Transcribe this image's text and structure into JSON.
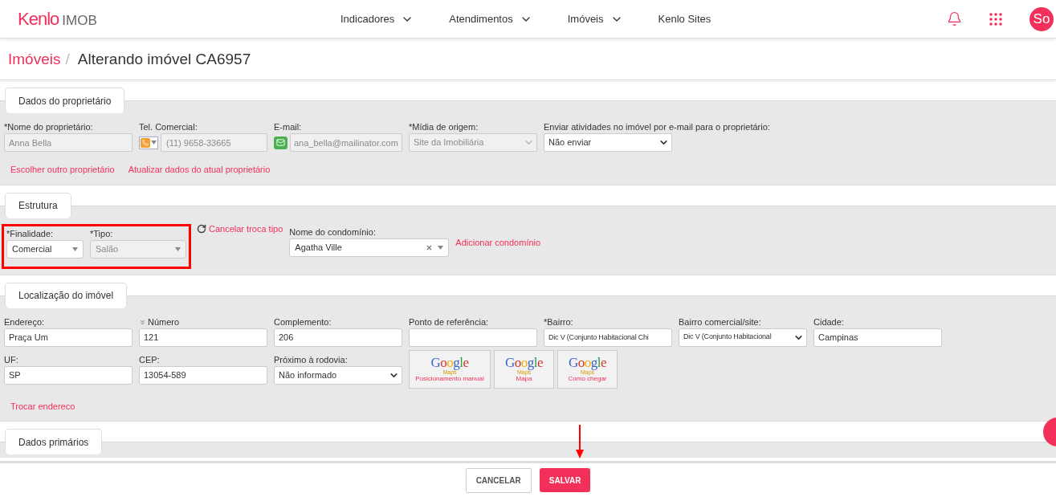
{
  "header": {
    "logo": {
      "brand": "Kenlo",
      "product": "IMOB"
    },
    "nav": [
      {
        "label": "Indicadores",
        "dropdown": true
      },
      {
        "label": "Atendimentos",
        "dropdown": true
      },
      {
        "label": "Imóveis",
        "dropdown": true
      },
      {
        "label": "Kenlo Sites",
        "dropdown": false
      }
    ],
    "avatar": "So"
  },
  "breadcrumb": {
    "parent": "Imóveis",
    "separator": "/",
    "title": "Alterando imóvel CA6957"
  },
  "sections": [
    {
      "title": "Dados do proprietário",
      "rows": [
        [
          {
            "kind": "text",
            "label": "*Nome do proprietário:",
            "value": "Anna Bella",
            "disabled": true
          },
          {
            "kind": "phone",
            "label": "Tel. Comercial:",
            "value": "(11) 9658-33665",
            "disabled": true
          },
          {
            "kind": "email",
            "label": "E-mail:",
            "value": "ana_bella@mailinator.com",
            "disabled": true
          },
          {
            "kind": "select",
            "label": "*Mídia de origem:",
            "value": "Site da Imobiliária",
            "disabled": true
          },
          {
            "kind": "select",
            "label": "Enviar atividades no imóvel por e-mail para o proprietário:",
            "value": "Não enviar",
            "disabled": false
          }
        ]
      ],
      "links": [
        "Escolher outro proprietário",
        "Atualizar dados do atual proprietário"
      ]
    },
    {
      "title": "Estrutura",
      "rows": [
        [
          {
            "kind": "group",
            "highlighted": true,
            "fields": [
              {
                "kind": "select2",
                "label": "*Finalidade:",
                "value": "Comercial",
                "disabled": false
              },
              {
                "kind": "select2",
                "label": "*Tipo:",
                "value": "Salão",
                "disabled": true
              }
            ]
          },
          {
            "kind": "action",
            "label": "Cancelar troca tipo"
          },
          {
            "kind": "select2",
            "label": "Nome do condomínio:",
            "value": "Agatha Ville",
            "disabled": false,
            "clearable": true
          },
          {
            "kind": "link",
            "label": "Adicionar condomínio"
          }
        ]
      ]
    },
    {
      "title": "Localização do imóvel",
      "rows": [
        [
          {
            "kind": "text",
            "label": "Endereço:",
            "value": "Praça Um",
            "disabled": false
          },
          {
            "kind": "text",
            "label": "Número",
            "value": "121",
            "disabled": false,
            "expand_icon": true
          },
          {
            "kind": "text",
            "label": "Complemento:",
            "value": "206",
            "disabled": false
          },
          {
            "kind": "text",
            "label": "Ponto de referência:",
            "disabled": false
          },
          {
            "kind": "text",
            "label": "*Bairro:",
            "value": "Dic V (Conjunto Habitacional Chi",
            "disabled": false
          },
          {
            "kind": "select",
            "label": "Bairro comercial/site:",
            "value": "Dic V (Conjunto Habitacional",
            "disabled": false
          },
          {
            "kind": "text",
            "label": "Cidade:",
            "value": "Campinas",
            "disabled": false
          }
        ],
        [
          {
            "kind": "text",
            "label": "UF:",
            "value": "SP",
            "disabled": false
          },
          {
            "kind": "text",
            "label": "CEP:",
            "value": "13054-589",
            "disabled": false
          },
          {
            "kind": "select",
            "label": "Próximo à rodovia:",
            "value": "Não informado",
            "disabled": false
          },
          {
            "kind": "maps",
            "buttons": [
              {
                "logo": "Google",
                "sub": "Maps",
                "label": "Posicionamento manual"
              },
              {
                "logo": "Google",
                "sub": "Maps",
                "label": "Mapa"
              },
              {
                "logo": "Google",
                "sub": "Maps",
                "label": "Como chegar"
              }
            ]
          }
        ]
      ],
      "links": [
        "Trocar endereco"
      ]
    },
    {
      "title": "Dados primários"
    }
  ],
  "footer": {
    "buttons": [
      {
        "label": "CANCELAR",
        "kind": "secondary"
      },
      {
        "label": "SALVAR",
        "kind": "primary"
      }
    ]
  }
}
